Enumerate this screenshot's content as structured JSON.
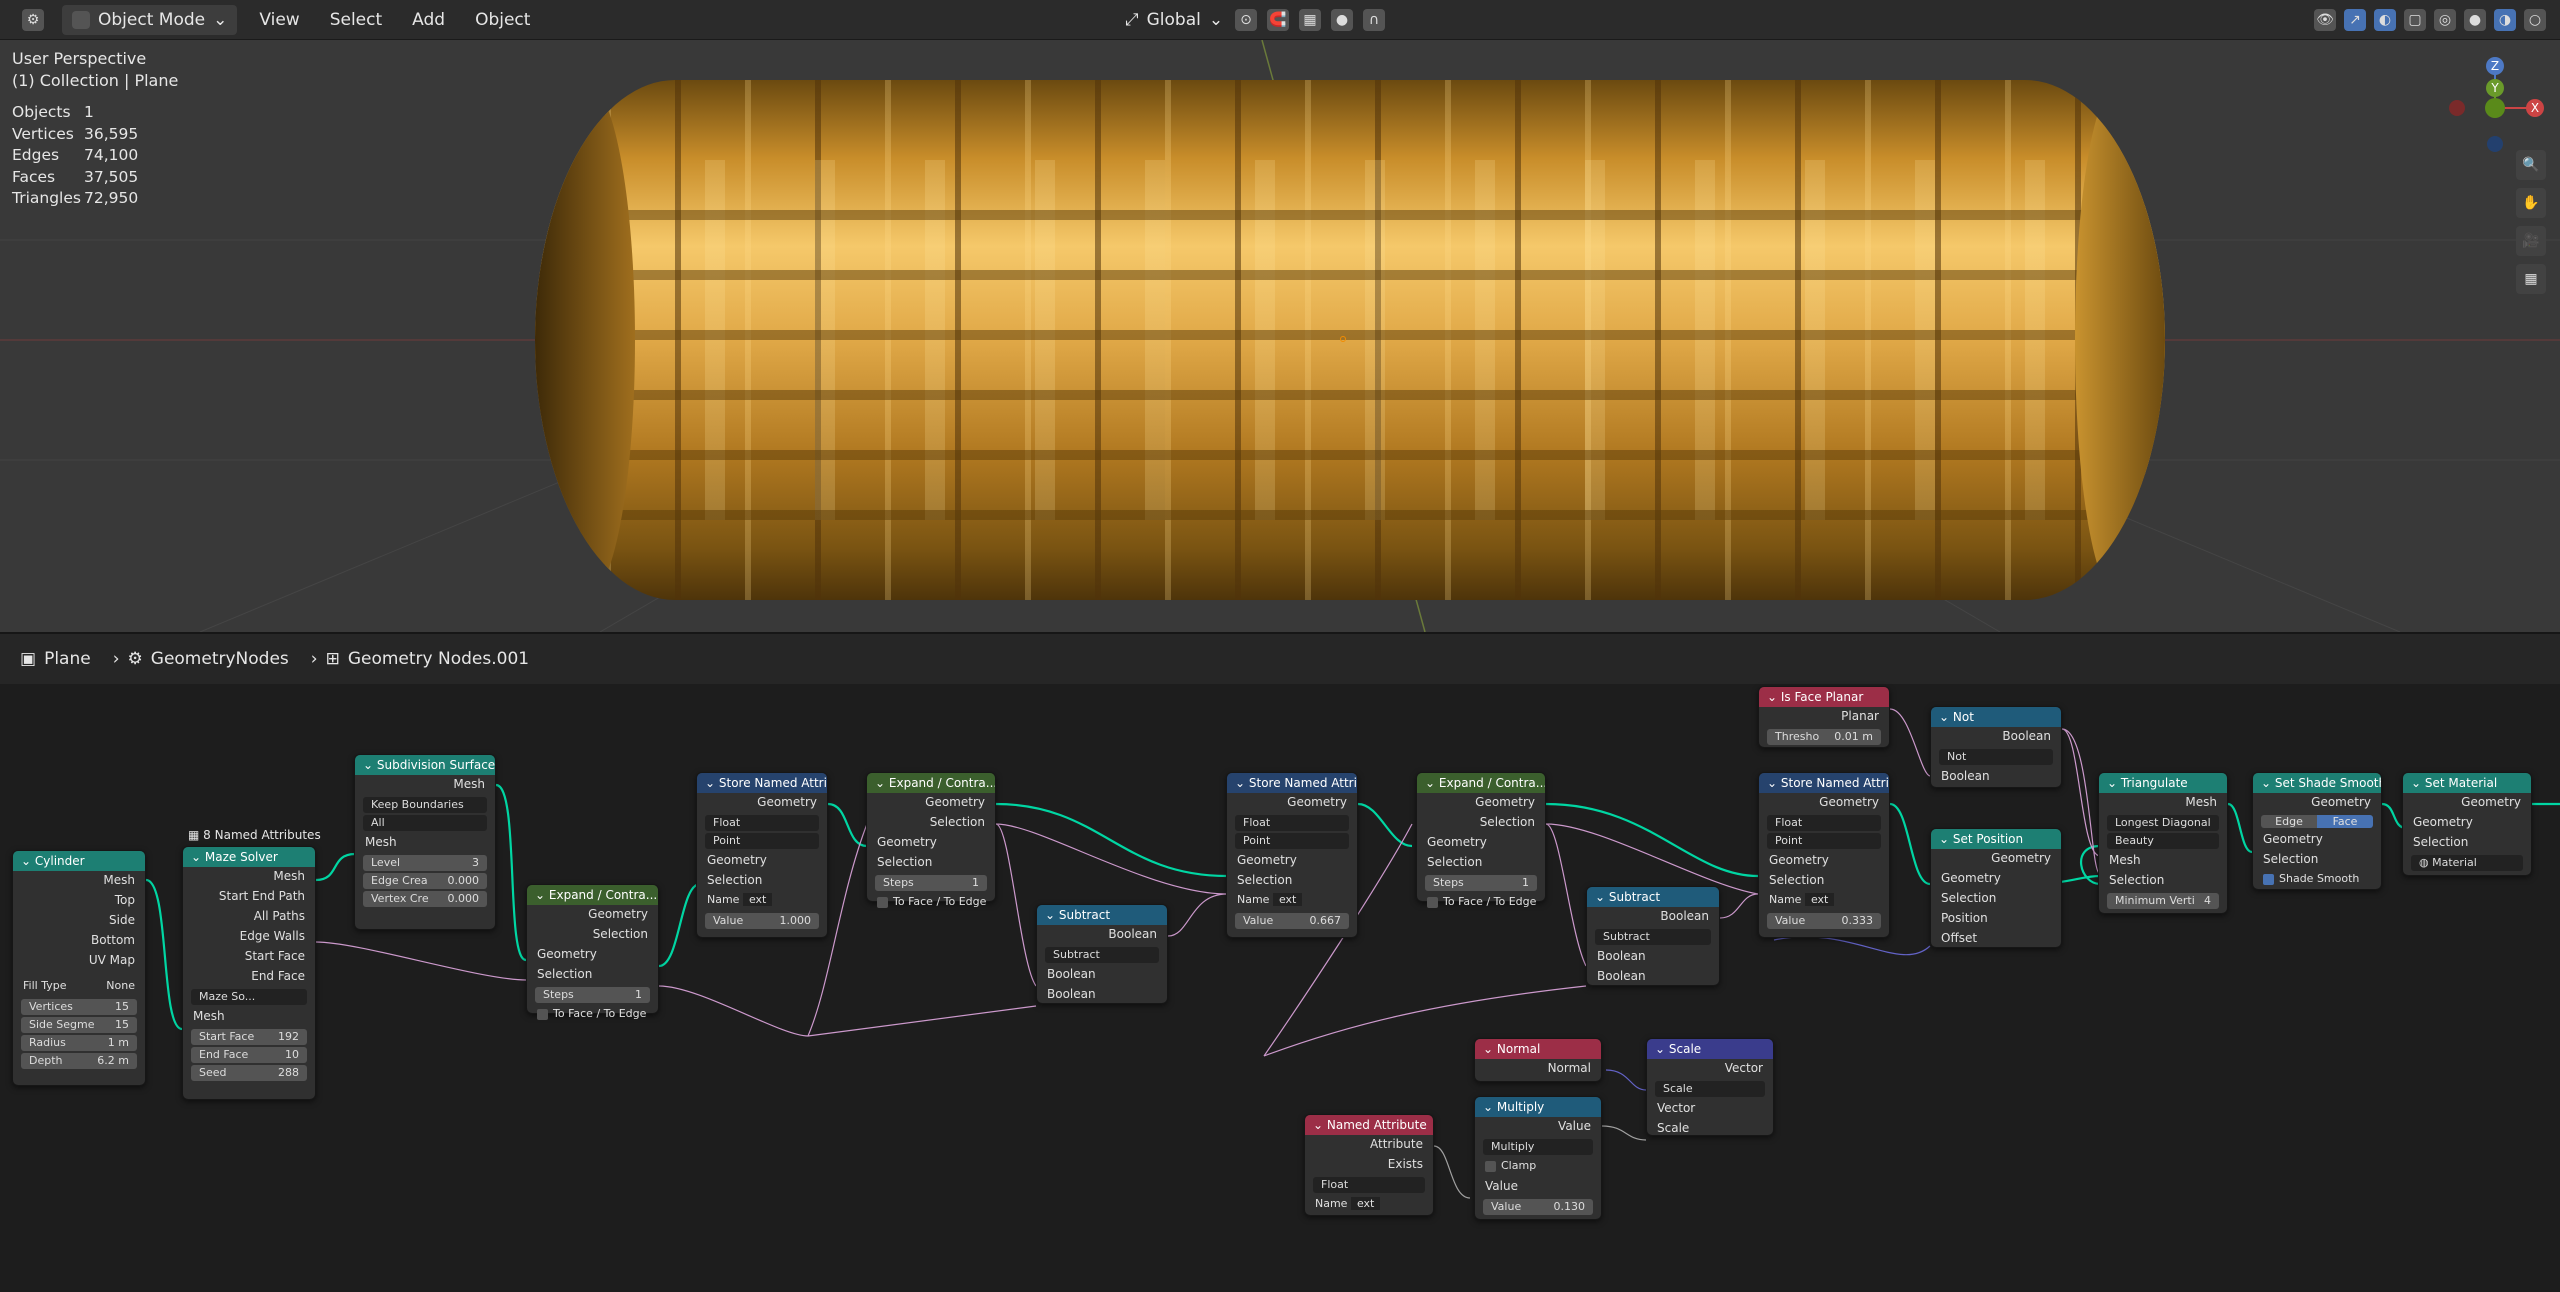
{
  "topbar": {
    "mode": "Object Mode",
    "menus": [
      "View",
      "Select",
      "Add",
      "Object"
    ],
    "transform_orientation": "Global"
  },
  "viewport": {
    "title": "User Perspective",
    "collection": "(1) Collection | Plane",
    "stats": [
      {
        "label": "Objects",
        "value": "1"
      },
      {
        "label": "Vertices",
        "value": "36,595"
      },
      {
        "label": "Edges",
        "value": "74,100"
      },
      {
        "label": "Faces",
        "value": "37,505"
      },
      {
        "label": "Triangles",
        "value": "72,950"
      }
    ],
    "gizmo_axes": [
      "Z",
      "Y",
      "X"
    ]
  },
  "breadcrumb": {
    "object": "Plane",
    "modifier": "GeometryNodes",
    "tree": "Geometry Nodes.001"
  },
  "nodes": {
    "cylinder": {
      "title": "Cylinder",
      "outs": [
        "Mesh",
        "Top",
        "Side",
        "Bottom",
        "UV Map"
      ],
      "fill_label": "Fill Type",
      "fill_value": "None",
      "fields": [
        [
          "Vertices",
          "15"
        ],
        [
          "Side Segme",
          "15"
        ],
        [
          "Radius",
          "1 m"
        ],
        [
          "Depth",
          "6.2 m"
        ]
      ]
    },
    "maze": {
      "title": "Maze Solver",
      "attr_label": "8 Named Attributes",
      "outs": [
        "Mesh",
        "Start End Path",
        "All Paths",
        "Edge Walls",
        "Start Face",
        "End Face"
      ],
      "group": "Maze So...",
      "in_mesh": "Mesh",
      "fields": [
        [
          "Start Face",
          "192"
        ],
        [
          "End Face",
          "10"
        ],
        [
          "Seed",
          "288"
        ]
      ]
    },
    "subdiv": {
      "title": "Subdivision Surface",
      "out": "Mesh",
      "dd1": "Keep Boundaries",
      "dd2": "All",
      "in_mesh": "Mesh",
      "fields": [
        [
          "Level",
          "3"
        ],
        [
          "Edge Crea",
          "0.000"
        ],
        [
          "Vertex Cre",
          "0.000"
        ]
      ]
    },
    "expand1": {
      "title": "Expand / Contra...",
      "outs": [
        "Geometry",
        "Selection"
      ],
      "ins": [
        "Geometry",
        "Selection"
      ],
      "steps": [
        "Steps",
        "1"
      ],
      "toface": "To Face / To Edge"
    },
    "store1": {
      "title": "Store Named Attrib...",
      "out": "Geometry",
      "dd1": "Float",
      "dd2": "Point",
      "ins": [
        "Geometry",
        "Selection"
      ],
      "name": [
        "Name",
        "ext"
      ],
      "value": [
        "Value",
        "1.000"
      ]
    },
    "expand2": {
      "title": "Expand / Contra...",
      "outs": [
        "Geometry",
        "Selection"
      ],
      "ins": [
        "Geometry",
        "Selection"
      ],
      "steps": [
        "Steps",
        "1"
      ],
      "toface": "To Face / To Edge"
    },
    "sub1": {
      "title": "Subtract",
      "out": "Boolean",
      "dd": "Subtract",
      "ins": [
        "Boolean",
        "Boolean"
      ]
    },
    "store2": {
      "title": "Store Named Attrib...",
      "out": "Geometry",
      "dd1": "Float",
      "dd2": "Point",
      "ins": [
        "Geometry",
        "Selection"
      ],
      "name": [
        "Name",
        "ext"
      ],
      "value": [
        "Value",
        "0.667"
      ]
    },
    "expand3": {
      "title": "Expand / Contra...",
      "outs": [
        "Geometry",
        "Selection"
      ],
      "ins": [
        "Geometry",
        "Selection"
      ],
      "steps": [
        "Steps",
        "1"
      ],
      "toface": "To Face / To Edge"
    },
    "sub2": {
      "title": "Subtract",
      "out": "Boolean",
      "dd": "Subtract",
      "ins": [
        "Boolean",
        "Boolean"
      ]
    },
    "store3": {
      "title": "Store Named Attrib...",
      "out": "Geometry",
      "dd1": "Float",
      "dd2": "Point",
      "ins": [
        "Geometry",
        "Selection"
      ],
      "name": [
        "Name",
        "ext"
      ],
      "value": [
        "Value",
        "0.333"
      ]
    },
    "isplanar": {
      "title": "Is Face Planar",
      "out": "Planar",
      "field": [
        "Thresho",
        "0.01 m"
      ]
    },
    "not": {
      "title": "Not",
      "out": "Boolean",
      "dd": "Not",
      "in": "Boolean"
    },
    "setpos": {
      "title": "Set Position",
      "out": "Geometry",
      "ins": [
        "Geometry",
        "Selection",
        "Position",
        "Offset"
      ]
    },
    "triangulate": {
      "title": "Triangulate",
      "out": "Mesh",
      "dd1": "Longest Diagonal",
      "dd2": "Beauty",
      "ins": [
        "Mesh",
        "Selection"
      ],
      "field": [
        "Minimum Verti",
        "4"
      ]
    },
    "shade": {
      "title": "Set Shade Smooth",
      "out": "Geometry",
      "mode_a": "Edge",
      "mode_b": "Face",
      "ins": [
        "Geometry",
        "Selection"
      ],
      "check": "Shade Smooth"
    },
    "material": {
      "title": "Set Material",
      "out": "Geometry",
      "ins": [
        "Geometry",
        "Selection"
      ],
      "mat": "Material"
    },
    "normal": {
      "title": "Normal",
      "out": "Normal"
    },
    "scale": {
      "title": "Scale",
      "out": "Vector",
      "dd": "Scale",
      "ins": [
        "Vector",
        "Scale"
      ]
    },
    "multiply": {
      "title": "Multiply",
      "out": "Value",
      "dd": "Multiply",
      "clamp": "Clamp",
      "in": "Value",
      "value": [
        "Value",
        "0.130"
      ]
    },
    "namedattr": {
      "title": "Named Attribute",
      "outs": [
        "Attribute",
        "Exists"
      ],
      "dd": "Float",
      "name": [
        "Name",
        "ext"
      ]
    }
  }
}
